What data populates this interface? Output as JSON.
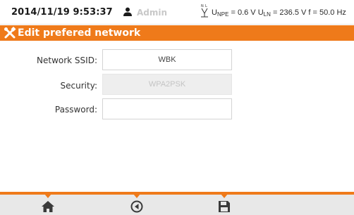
{
  "status_bar": {
    "datetime": "2014/11/19 9:53:37",
    "user": "Admin",
    "user_icon": "user-icon",
    "measurement_icon": "terminal-connection-icon",
    "upe_label": "U",
    "upe_sub": "NPE",
    "upe_value": "= 0.6 V",
    "uln_label": "U",
    "uln_sub": "LN",
    "uln_value": "= 236.5 V",
    "freq": "f = 50.0 Hz"
  },
  "title_bar": {
    "icon": "tools-icon",
    "title": "Edit prefered network"
  },
  "form": {
    "ssid": {
      "label": "Network SSID:",
      "value": "WBK"
    },
    "security": {
      "label": "Security:",
      "value": "WPA2PSK"
    },
    "password": {
      "label": "Password:",
      "value": ""
    }
  },
  "toolbar": {
    "buttons": [
      {
        "icon": "home-icon"
      },
      {
        "icon": "back-icon"
      },
      {
        "icon": "save-icon"
      }
    ]
  },
  "colors": {
    "accent": "#ef7a1a",
    "toolbar_bg": "#e8e8e8",
    "disabled_text": "#c4c4c4"
  }
}
